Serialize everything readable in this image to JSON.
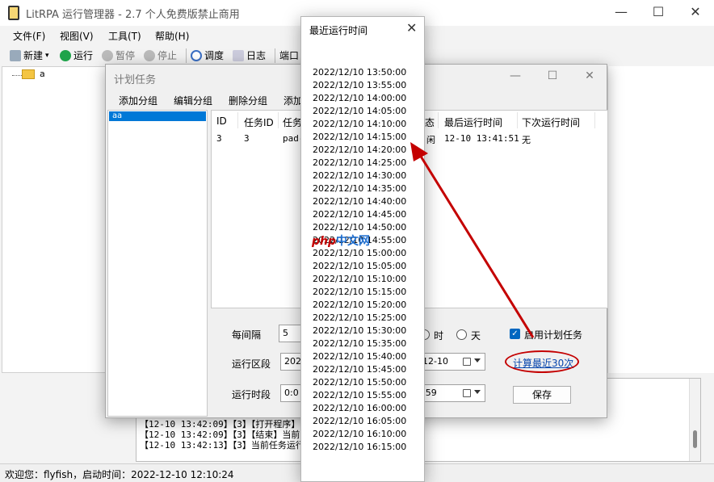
{
  "app": {
    "title": "LitRPA 运行管理器 - 2.7 个人免费版禁止商用",
    "window_controls": {
      "minimize": "—",
      "maximize": "☐",
      "close": "✕"
    },
    "menu": [
      "文件(F)",
      "视图(V)",
      "工具(T)",
      "帮助(H)"
    ],
    "toolbar": {
      "new": "新建",
      "run": "运行",
      "pause": "暂停",
      "stop": "停止",
      "schedule": "调度",
      "log": "日志",
      "port": "端口"
    },
    "tree_item": "a",
    "status_bar": "欢迎您：flyfish，启动时间：2022-12-10 12:10:24"
  },
  "log": {
    "lines": [
      "【12-10 13:42:09】【3】【打开程序】",
      "【12-10 13:42:09】【3】【结束】当前",
      "【12-10 13:42:13】【3】当前任务运行"
    ]
  },
  "plan_dialog": {
    "title": "计划任务",
    "window_controls": {
      "minimize": "—",
      "maximize": "☐",
      "close": "✕"
    },
    "menu": [
      "添加分组",
      "编辑分组",
      "删除分组",
      "添加"
    ],
    "group_selected": "aa",
    "table": {
      "headers": {
        "id": "ID",
        "task_id": "任务ID",
        "task": "任务",
        "status": "态",
        "last_run": "最后运行时间",
        "next_run": "下次运行时间"
      },
      "row": {
        "id": "3",
        "task_id": "3",
        "task": "pad-",
        "status": "闲",
        "last_run": "12-10 13:41:51",
        "next_run": "无"
      }
    },
    "form": {
      "interval_label": "每间隔",
      "interval_value": "5",
      "unit_hour": "时",
      "unit_day": "天",
      "enable_label": "启用计划任务",
      "range_label": "运行区段",
      "range_start": "2022",
      "range_end": "12-10",
      "period_label": "运行时段",
      "period_start": "0:0",
      "period_end": ":59",
      "calc_link": "计算最近30次",
      "save": "保存"
    }
  },
  "recent_popup": {
    "title": "最近运行时间",
    "close": "✕",
    "times": [
      "2022/12/10 13:50:00",
      "2022/12/10 13:55:00",
      "2022/12/10 14:00:00",
      "2022/12/10 14:05:00",
      "2022/12/10 14:10:00",
      "2022/12/10 14:15:00",
      "2022/12/10 14:20:00",
      "2022/12/10 14:25:00",
      "2022/12/10 14:30:00",
      "2022/12/10 14:35:00",
      "2022/12/10 14:40:00",
      "2022/12/10 14:45:00",
      "2022/12/10 14:50:00",
      "2022/12/10 14:55:00",
      "2022/12/10 15:00:00",
      "2022/12/10 15:05:00",
      "2022/12/10 15:10:00",
      "2022/12/10 15:15:00",
      "2022/12/10 15:20:00",
      "2022/12/10 15:25:00",
      "2022/12/10 15:30:00",
      "2022/12/10 15:35:00",
      "2022/12/10 15:40:00",
      "2022/12/10 15:45:00",
      "2022/12/10 15:50:00",
      "2022/12/10 15:55:00",
      "2022/12/10 16:00:00",
      "2022/12/10 16:05:00",
      "2022/12/10 16:10:00",
      "2022/12/10 16:15:00"
    ]
  },
  "watermark": {
    "php": "php",
    "cn": "中文网"
  },
  "colors": {
    "accent": "#0078d7",
    "annotation_red": "#c40000",
    "link": "#0645ad"
  }
}
